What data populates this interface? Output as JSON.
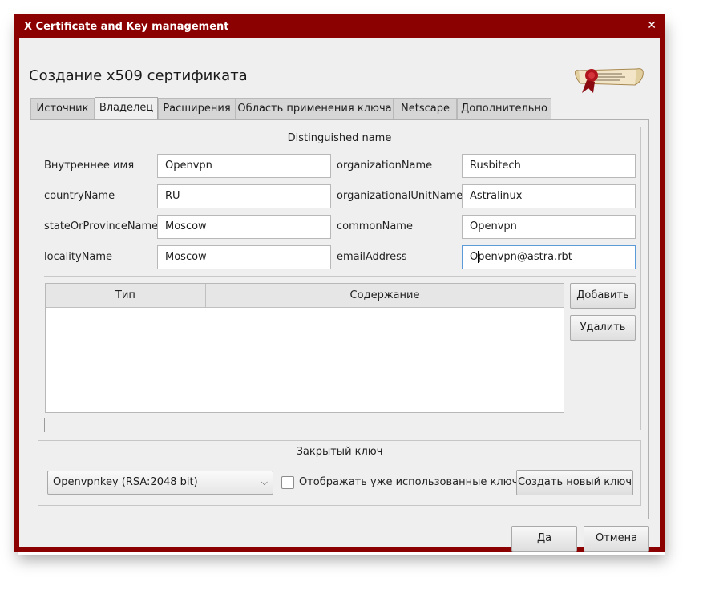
{
  "window": {
    "title": "X Certificate and Key management",
    "close_glyph": "✕"
  },
  "dialog": {
    "heading": "Создание x509 сертификата",
    "logo_icon": "xca-scroll-logo-icon"
  },
  "tabs": [
    {
      "label": "Источник",
      "active": false
    },
    {
      "label": "Владелец",
      "active": true
    },
    {
      "label": "Расширения",
      "active": false
    },
    {
      "label": "Область применения ключа",
      "active": false
    },
    {
      "label": "Netscape",
      "active": false
    },
    {
      "label": "Дополнительно",
      "active": false
    }
  ],
  "owner": {
    "group_title": "Distinguished name",
    "fields_left": [
      {
        "label": "Внутреннее имя",
        "value": "Openvpn"
      },
      {
        "label": "countryName",
        "value": "RU"
      },
      {
        "label": "stateOrProvinceName",
        "value": "Moscow"
      },
      {
        "label": "localityName",
        "value": "Moscow"
      }
    ],
    "fields_right": [
      {
        "label": "organizationName",
        "value": "Rusbitech"
      },
      {
        "label": "organizationalUnitName",
        "value": "Astralinux"
      },
      {
        "label": "commonName",
        "value": "Openvpn"
      },
      {
        "label": "emailAddress",
        "value_prefix": "O",
        "value_suffix": "penvpn@astra.rbt"
      }
    ],
    "table": {
      "columns": [
        "Тип",
        "Содержание"
      ],
      "rows": []
    },
    "add_button": "Добавить",
    "remove_button": "Удалить"
  },
  "private_key": {
    "group_title": "Закрытый ключ",
    "selected_key": "Openvpnkey (RSA:2048 bit)",
    "show_used_keys_label": "Отображать уже использованные ключи",
    "show_used_keys_checked": false,
    "generate_button": "Создать новый ключ"
  },
  "footer": {
    "ok_button": "Да",
    "cancel_button": "Отмена"
  },
  "colors": {
    "title_bar": "#8b0000",
    "focus_border": "#5c9ad8"
  }
}
